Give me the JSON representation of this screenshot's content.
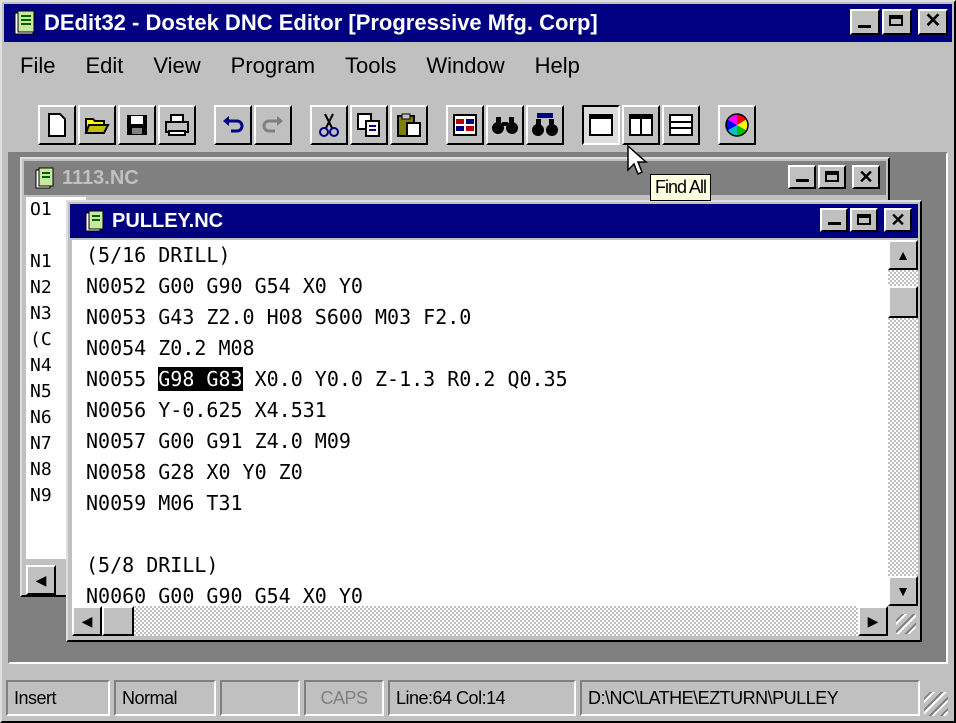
{
  "app": {
    "title": "DEdit32 - Dostek DNC Editor [Progressive Mfg. Corp]"
  },
  "menu": [
    {
      "label": "File"
    },
    {
      "label": "Edit"
    },
    {
      "label": "View"
    },
    {
      "label": "Program"
    },
    {
      "label": "Tools"
    },
    {
      "label": "Window"
    },
    {
      "label": "Help"
    }
  ],
  "toolbar": {
    "icons": [
      "new-icon",
      "open-icon",
      "save-icon",
      "print-icon",
      "undo-icon",
      "redo-icon",
      "cut-icon",
      "copy-icon",
      "paste-icon",
      "compare-icon",
      "find-icon",
      "find-all-icon",
      "single-view-icon",
      "split-vertical-icon",
      "split-horizontal-icon",
      "color-icon"
    ]
  },
  "tooltip": {
    "text": "Find All"
  },
  "back_window": {
    "title": "1113.NC",
    "lines": [
      "O1",
      "",
      "N1",
      "N2",
      "N3",
      "(C",
      "N4",
      "N5",
      "N6",
      "N7",
      "N8",
      "N9"
    ]
  },
  "front_window": {
    "title": "PULLEY.NC",
    "lines": [
      "(5/16 DRILL)",
      "N0052 G00 G90 G54 X0 Y0",
      "N0053 G43 Z2.0 H08 S600 M03 F2.0",
      "N0054 Z0.2 M08",
      "N0056 Y-0.625 X4.531",
      "N0057 G00 G91 Z4.0 M09",
      "N0058 G28 X0 Y0 Z0",
      "N0059 M06 T31",
      "",
      "(5/8 DRILL)",
      "N0060 G00 G90 G54 X0 Y0"
    ],
    "selected_line": {
      "prefix": "N0055 ",
      "selection": "G98 G83",
      "suffix": " X0.0 Y0.0 Z-1.3 R0.2 Q0.35"
    }
  },
  "status": {
    "mode": "Insert",
    "view": "Normal",
    "empty": "",
    "caps": "CAPS",
    "position": "Line:64 Col:14",
    "path": "D:\\NC\\LATHE\\EZTURN\\PULLEY"
  },
  "colors": {
    "active_title": "#000080",
    "inactive_title": "#808080",
    "face": "#c0c0c0"
  }
}
